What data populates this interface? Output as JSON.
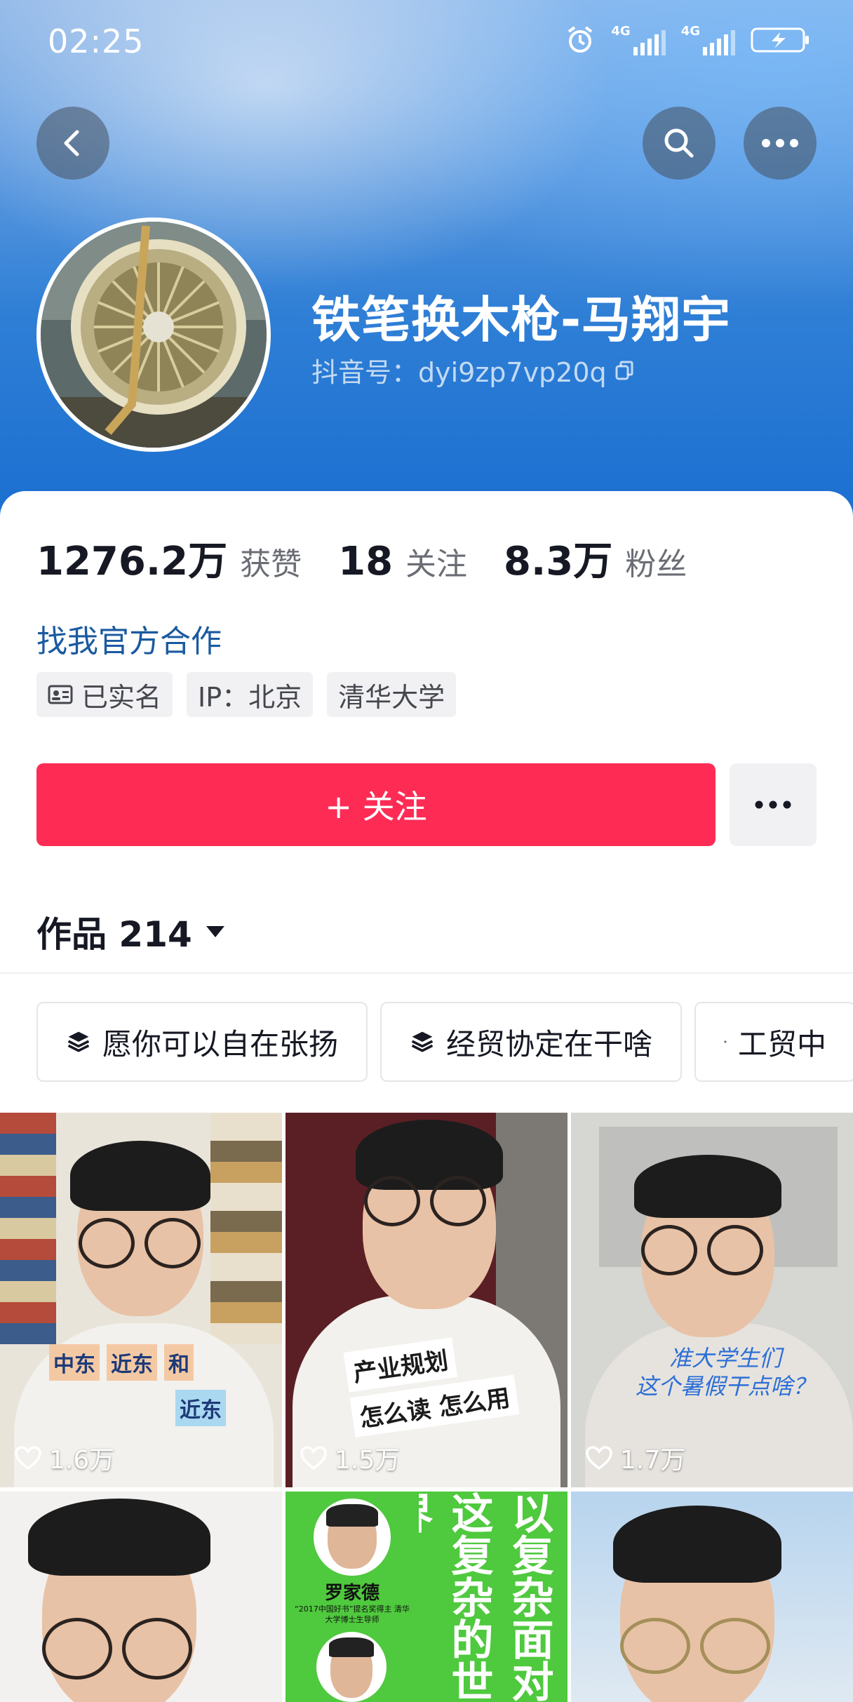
{
  "status_bar": {
    "time": "02:25",
    "network_1": "4G",
    "network_2": "4G"
  },
  "header": {
    "name": "铁笔换木枪-马翔宇",
    "douyin_id": "抖音号：dyi9zp7vp20q"
  },
  "stats": [
    {
      "value": "1276.2万",
      "label": "获赞"
    },
    {
      "value": "18",
      "label": "关注"
    },
    {
      "value": "8.3万",
      "label": "粉丝"
    }
  ],
  "link": "找我官方合作",
  "tags": [
    {
      "label": "已实名",
      "icon": "id-card-icon"
    },
    {
      "label": "IP：北京"
    },
    {
      "label": "清华大学"
    }
  ],
  "follow_button": "+ 关注",
  "works": {
    "label": "作品 214"
  },
  "collections": [
    "愿你可以自在张扬",
    "经贸协定在干啥",
    "工贸中"
  ],
  "videos": [
    {
      "likes": "1.6万",
      "caption": [
        "中东",
        "近东",
        "和",
        "近东"
      ]
    },
    {
      "likes": "1.5万",
      "caption": [
        "产业规划",
        "怎么读 怎么用"
      ]
    },
    {
      "likes": "1.7万",
      "caption": [
        "准大学生们",
        "这个暑假干点啥？"
      ]
    },
    {
      "likes": ""
    },
    {
      "likes": "",
      "text_big": "以复杂面对这复杂的世界",
      "person": "罗家德",
      "person_sub": "“2017中国好书”提名奖得主 清华大学博士生导师"
    },
    {
      "likes": ""
    }
  ],
  "colors": {
    "accent": "#fe2c55",
    "link": "#1a5aa0"
  }
}
